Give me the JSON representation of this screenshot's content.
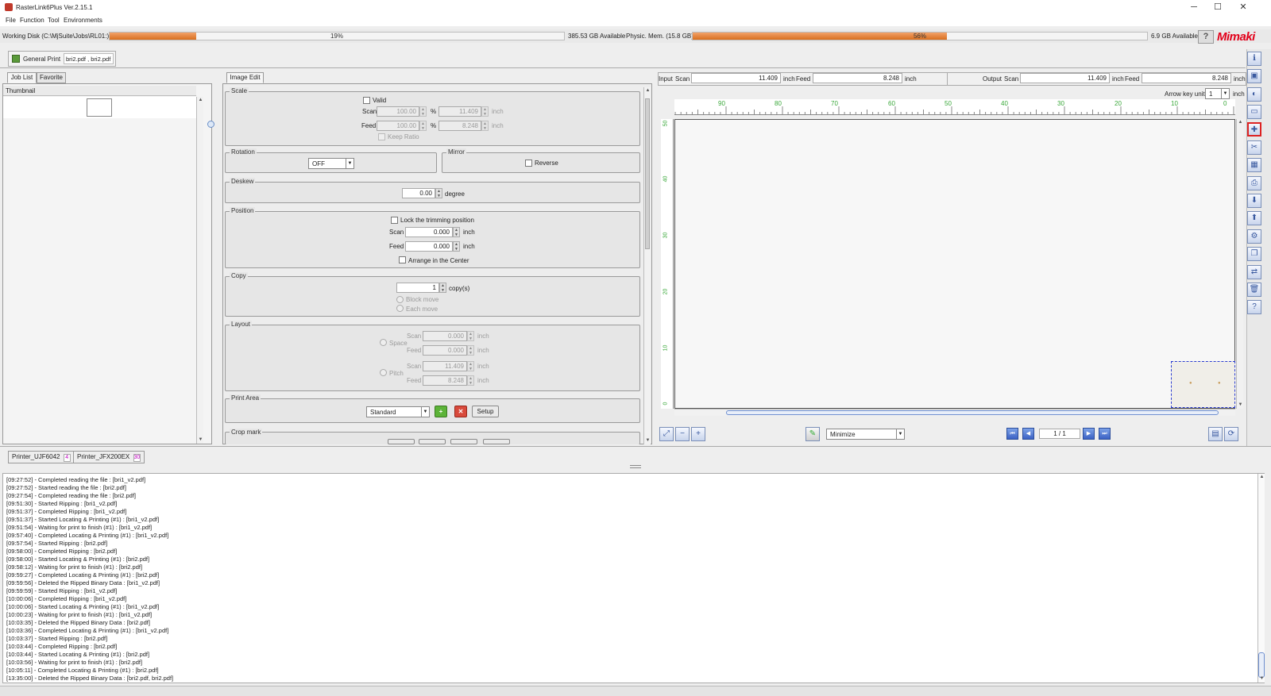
{
  "window": {
    "title": "RasterLink6Plus Ver.2.15.1",
    "minimize": "─",
    "maximize": "☐",
    "close": "✕"
  },
  "menu": [
    "File",
    "Function",
    "Tool",
    "Environments"
  ],
  "disk": {
    "working_label": "Working Disk (C:\\MjSuite\\Jobs\\RL01:)",
    "working_pct_text": "19%",
    "working_fill": 0.19,
    "working_available": "385.53 GB Available",
    "memory_label": "Physic. Mem. (15.8 GB)",
    "memory_pct_text": "56%",
    "memory_fill": 0.56,
    "memory_available": "6.9 GB Available",
    "help": "?",
    "logo": "Mimaki"
  },
  "job_tab": {
    "label": "General Print",
    "files": "bri2.pdf , bri2.pdf"
  },
  "left": {
    "tabs": [
      "Job List",
      "Favorite"
    ],
    "column_header": "Thumbnail"
  },
  "editor": {
    "tab": "Image Edit",
    "scale": {
      "title": "Scale",
      "valid": "Valid",
      "scan_label": "Scan",
      "feed_label": "Feed",
      "scan_pct": "100.00",
      "feed_pct": "100.00",
      "pct_unit": "%",
      "scan_inch": "11.409",
      "feed_inch": "8.248",
      "inch": "inch",
      "keep_ratio": "Keep Ratio"
    },
    "rotation": {
      "title": "Rotation",
      "value": "OFF"
    },
    "mirror": {
      "title": "Mirror",
      "reverse": "Reverse"
    },
    "deskew": {
      "title": "Deskew",
      "value": "0.00",
      "unit": "degree"
    },
    "position": {
      "title": "Position",
      "lock": "Lock the trimming position",
      "scan_label": "Scan",
      "feed_label": "Feed",
      "scan": "0.000",
      "feed": "0.000",
      "inch": "inch",
      "center": "Arrange in the Center"
    },
    "copy": {
      "title": "Copy",
      "value": "1",
      "unit": "copy(s)",
      "block_move": "Block move",
      "each_move": "Each move"
    },
    "layout": {
      "title": "Layout",
      "space": "Space",
      "pitch": "Pitch",
      "scan_label": "Scan",
      "feed_label": "Feed",
      "space_scan": "0.000",
      "space_feed": "0.000",
      "pitch_scan": "11.409",
      "pitch_feed": "8.248",
      "inch": "inch"
    },
    "print_area": {
      "title": "Print Area",
      "value": "Standard",
      "add": "+",
      "remove": "✕",
      "setup": "Setup"
    },
    "crop_mark": {
      "title": "Crop mark"
    }
  },
  "preview": {
    "input_label": "Input",
    "output_label": "Output",
    "scan_label": "Scan",
    "feed_label": "Feed",
    "inch": "inch",
    "input_scan": "11.409",
    "input_feed": "8.248",
    "output_scan": "11.409",
    "output_feed": "8.248",
    "arrow_key_label": "Arrow key unit",
    "arrow_key_value": "1",
    "ruler_top": [
      "90",
      "80",
      "70",
      "60",
      "50",
      "40",
      "30",
      "20",
      "10",
      "0"
    ],
    "ruler_left": [
      "50",
      "40",
      "30",
      "20",
      "10",
      "0"
    ],
    "zoom_mode": "Minimize",
    "page": "1 / 1"
  },
  "printers": [
    {
      "name": "Printer_UJF6042",
      "count": "4"
    },
    {
      "name": "Printer_JFX200EX",
      "count": "30"
    }
  ],
  "log": [
    "[09:27:52] - Completed reading the file : [bri1_v2.pdf]",
    "[09:27:52] - Started reading the file : [bri2.pdf]",
    "[09:27:54] - Completed reading the file : [bri2.pdf]",
    "[09:51:30] - Started Ripping : [bri1_v2.pdf]",
    "[09:51:37] - Completed Ripping : [bri1_v2.pdf]",
    "[09:51:37] - Started Locating & Printing (#1) : [bri1_v2.pdf]",
    "[09:51:54] - Waiting for print to finish (#1) : [bri1_v2.pdf]",
    "[09:57:40] - Completed Locating & Printing (#1) : [bri1_v2.pdf]",
    "[09:57:54] - Started Ripping : [bri2.pdf]",
    "[09:58:00] - Completed Ripping : [bri2.pdf]",
    "[09:58:00] - Started Locating & Printing (#1) : [bri2.pdf]",
    "[09:58:12] - Waiting for print to finish (#1) : [bri2.pdf]",
    "[09:59:27] - Completed Locating & Printing (#1) : [bri2.pdf]",
    "[09:59:56] - Deleted the Ripped Binary Data : [bri1_v2.pdf]",
    "[09:59:59] - Started Ripping : [bri1_v2.pdf]",
    "[10:00:06] - Completed Ripping : [bri1_v2.pdf]",
    "[10:00:06] - Started Locating & Printing (#1) : [bri1_v2.pdf]",
    "[10:00:23] - Waiting for print to finish (#1) : [bri1_v2.pdf]",
    "[10:03:35] - Deleted the Ripped Binary Data : [bri2.pdf]",
    "[10:03:36] - Completed Locating & Printing (#1) : [bri1_v2.pdf]",
    "[10:03:37] - Started Ripping : [bri2.pdf]",
    "[10:03:44] - Completed Ripping : [bri2.pdf]",
    "[10:03:44] - Started Locating & Printing (#1) : [bri2.pdf]",
    "[10:03:56] - Waiting for print to finish (#1) : [bri2.pdf]",
    "[10:05:11] - Completed Locating & Printing (#1) : [bri2.pdf]",
    "[13:35:00] - Deleted the Ripped Binary Data : [bri2.pdf, bri2.pdf]"
  ]
}
